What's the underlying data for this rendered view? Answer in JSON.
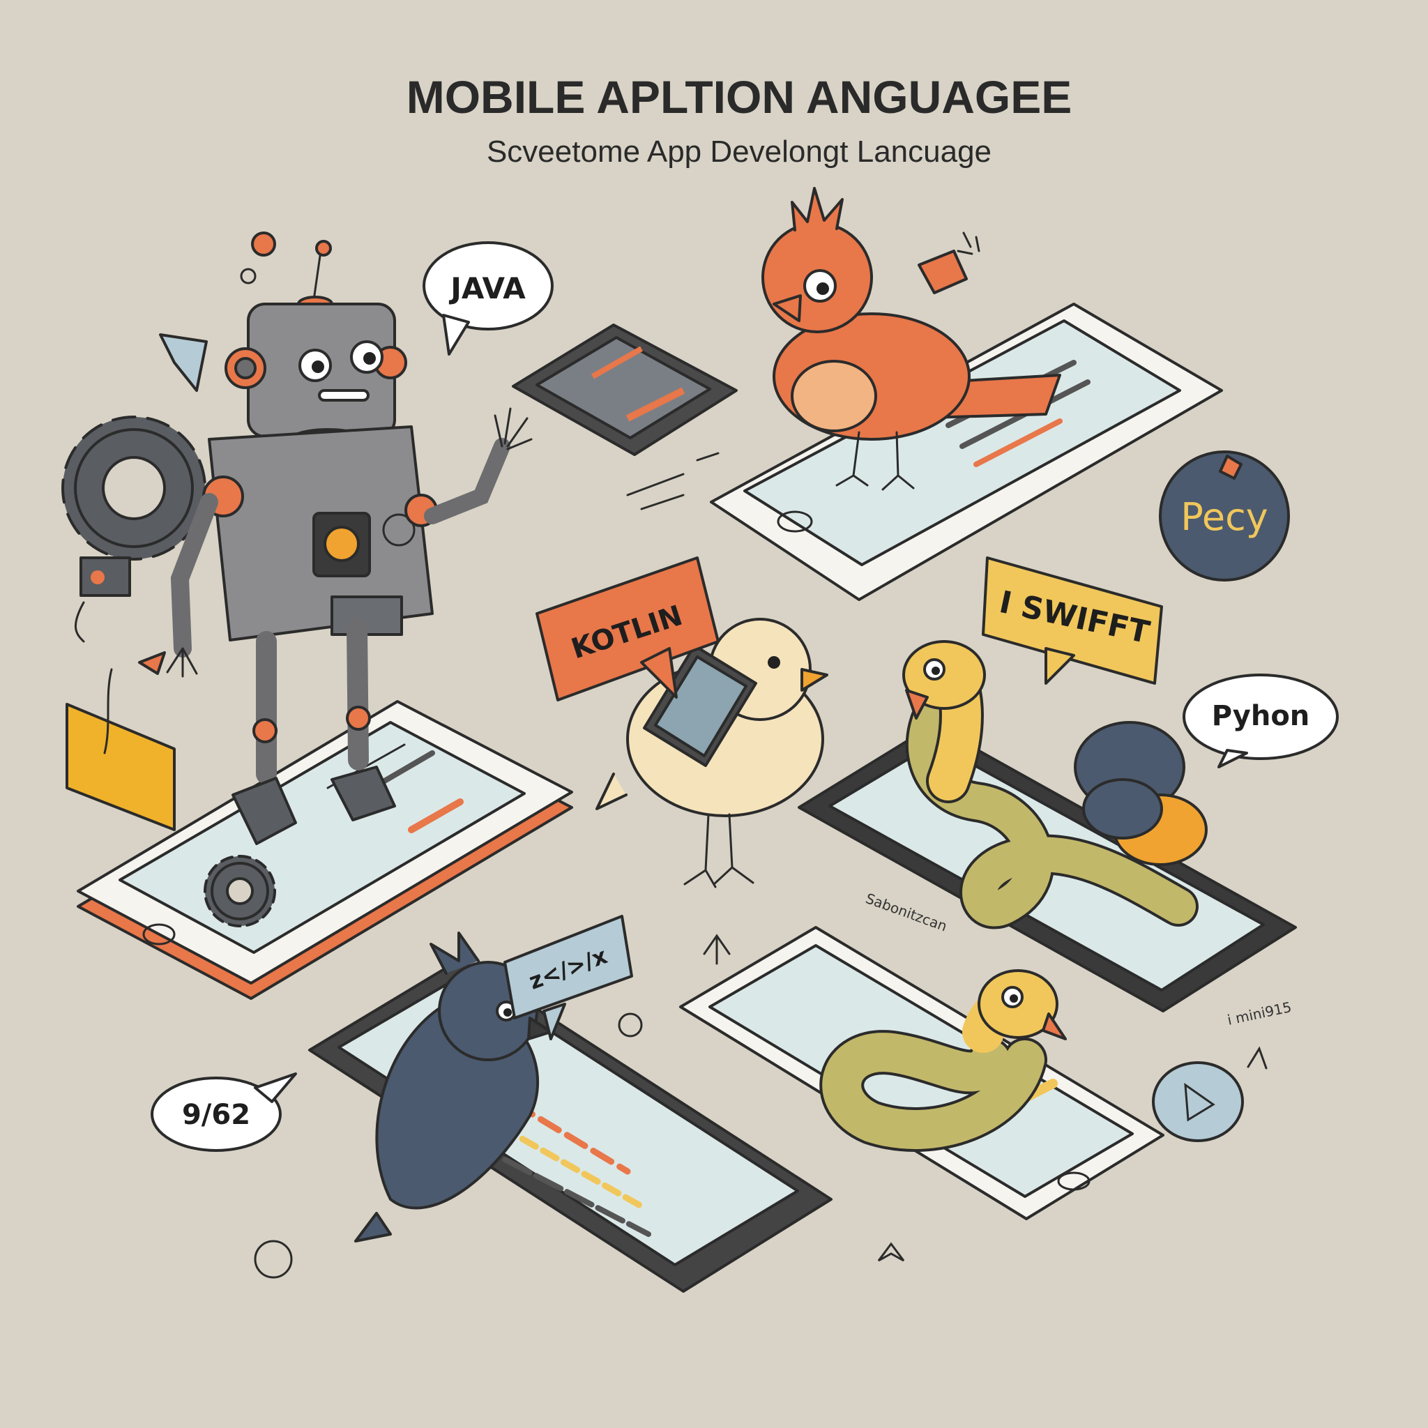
{
  "header": {
    "title": "MOBILE APLTION ANGUAGEE",
    "subtitle": "Scveetome App Develongt Lancuage"
  },
  "bubbles": {
    "java": "JAVA",
    "kotlin": "KOTLIN",
    "swift": "I SWIFFT",
    "pecy": "Pecy",
    "python": "Pyhon",
    "code": "z</>/x",
    "number": "9/62"
  },
  "signatures": {
    "left": "Sabonitzcan",
    "right": "i mini915"
  },
  "palette": {
    "background": "#d8d3c6",
    "robot": "#8c8c8e",
    "accent_orange": "#e8774a",
    "yellow": "#f1c75b",
    "navy": "#4b5a6e",
    "screen": "#dbe8e8"
  }
}
